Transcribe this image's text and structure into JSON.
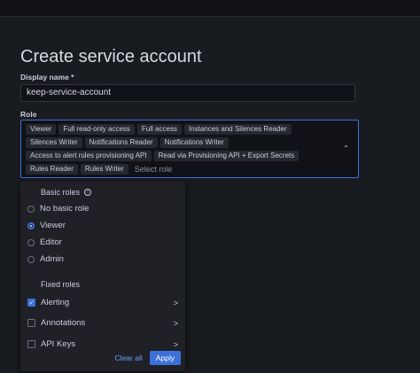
{
  "page": {
    "title": "Create service account"
  },
  "display_name": {
    "label": "Display name *",
    "value": "keep-service-account"
  },
  "role": {
    "label": "Role",
    "chips": [
      "Viewer",
      "Full read-only access",
      "Full access",
      "Instances and Silences Reader",
      "Silences Writer",
      "Notifications Reader",
      "Notifications Writer",
      "Access to alert rules provisioning API",
      "Read via Provisioning API + Export Secrets",
      "Rules Reader",
      "Rules Writer"
    ],
    "placeholder": "Select role"
  },
  "dropdown": {
    "basic_roles_title": "Basic roles",
    "basic_roles": [
      {
        "label": "No basic role",
        "checked": false
      },
      {
        "label": "Viewer",
        "checked": true
      },
      {
        "label": "Editor",
        "checked": false
      },
      {
        "label": "Admin",
        "checked": false
      }
    ],
    "fixed_roles_title": "Fixed roles",
    "fixed_roles": [
      {
        "label": "Alerting",
        "checked": true
      },
      {
        "label": "Annotations",
        "checked": false
      },
      {
        "label": "API Keys",
        "checked": false
      }
    ],
    "clear_all": "Clear all",
    "apply": "Apply"
  },
  "icons": {
    "chevron_right": ">",
    "chevron_up": "⌃",
    "info": "i",
    "check": "✓"
  },
  "colors": {
    "accent": "#3d71d9",
    "background": "#181b1f"
  }
}
